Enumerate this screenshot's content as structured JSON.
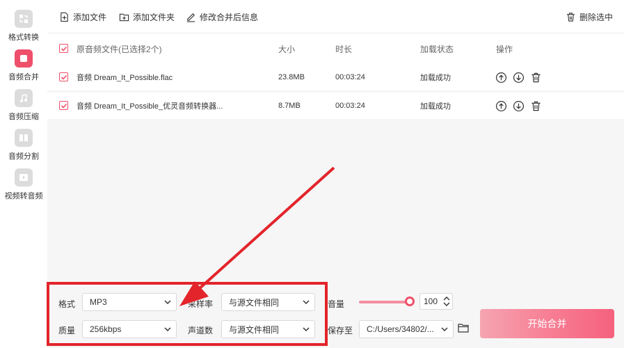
{
  "sidebar": {
    "items": [
      {
        "label": "格式转换",
        "icon": "format-convert-icon",
        "active": false
      },
      {
        "label": "音频合并",
        "icon": "audio-merge-icon",
        "active": true
      },
      {
        "label": "音频压缩",
        "icon": "audio-compress-icon",
        "active": false
      },
      {
        "label": "音频分割",
        "icon": "audio-split-icon",
        "active": false
      },
      {
        "label": "视频转音频",
        "icon": "video-to-audio-icon",
        "active": false
      }
    ]
  },
  "toolbar": {
    "add_file": "添加文件",
    "add_folder": "添加文件夹",
    "edit_info": "修改合并后信息",
    "delete_selected": "删除选中"
  },
  "table": {
    "headers": {
      "name": "原音频文件(已选择2个)",
      "size": "大小",
      "duration": "时长",
      "status": "加载状态",
      "actions": "操作"
    },
    "rows": [
      {
        "name": "音频 Dream_It_Possible.flac",
        "size": "23.8MB",
        "duration": "00:03:24",
        "status": "加载成功",
        "checked": true
      },
      {
        "name": "音频 Dream_It_Possible_优灵音频转换器...",
        "size": "8.7MB",
        "duration": "00:03:24",
        "status": "加载成功",
        "checked": true
      }
    ]
  },
  "settings": {
    "format_label": "格式",
    "format_value": "MP3",
    "quality_label": "质量",
    "quality_value": "256kbps",
    "samplerate_label": "采样率",
    "samplerate_value": "与源文件相同",
    "channels_label": "声道数",
    "channels_value": "与源文件相同",
    "volume_label": "音量",
    "volume_value": "100",
    "volume_level": 1.0,
    "saveto_label": "保存至",
    "saveto_value": "C:/Users/34802/..."
  },
  "actions": {
    "start_merge": "开始合并"
  },
  "colors": {
    "accent": "#ee4f6a",
    "annotation": "#e3242b"
  }
}
